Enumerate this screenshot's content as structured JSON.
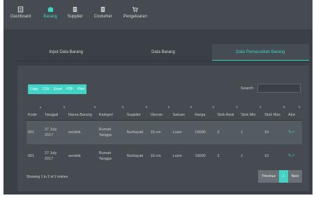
{
  "nav": {
    "items": [
      {
        "label": "Dashboard",
        "icon": "dashboard-icon"
      },
      {
        "label": "Barang",
        "icon": "box-icon"
      },
      {
        "label": "Supplier",
        "icon": "supplier-icon"
      },
      {
        "label": "Costumer",
        "icon": "costumer-icon"
      },
      {
        "label": "Pengeluaran",
        "icon": "cart-icon"
      }
    ],
    "active": "Barang"
  },
  "tabs": [
    "Input Data Barang",
    "Data Barang",
    "Data Pemasukkan Barang"
  ],
  "toolbar": {
    "buttons": [
      "Copy",
      "CSV",
      "Excel",
      "PDF",
      "Print"
    ]
  },
  "search": {
    "label": "Search:",
    "value": ""
  },
  "table": {
    "headers": [
      "Kode",
      "Tanggal",
      "Nama Barang",
      "Kategori",
      "Supplier",
      "Ukuran",
      "Satuan",
      "Harga",
      "Stok Awal",
      "Stok Min",
      "Stok Max",
      "Aksi"
    ],
    "rows": [
      [
        "001",
        "27 July 2017",
        "sendok",
        "Rumah Tangga",
        "Nurhayati",
        "10 cm",
        "Lusin",
        "15000",
        "3",
        "1",
        "10",
        "✎✓"
      ],
      [
        "001",
        "27 July 2017",
        "sendok",
        "Rumah Tangga",
        "Nurhayati",
        "10 cm",
        "Lusin",
        "15000",
        "2",
        "1",
        "10",
        "✎✓"
      ]
    ]
  },
  "footer": {
    "info": "Showing 1 to 2 of 2 entries"
  },
  "pagination": {
    "previous": "Previous",
    "page": "1",
    "next": "Next"
  },
  "colors": {
    "accent": "#41d3c6",
    "background": "#3a4046",
    "panel": "#454b51"
  }
}
